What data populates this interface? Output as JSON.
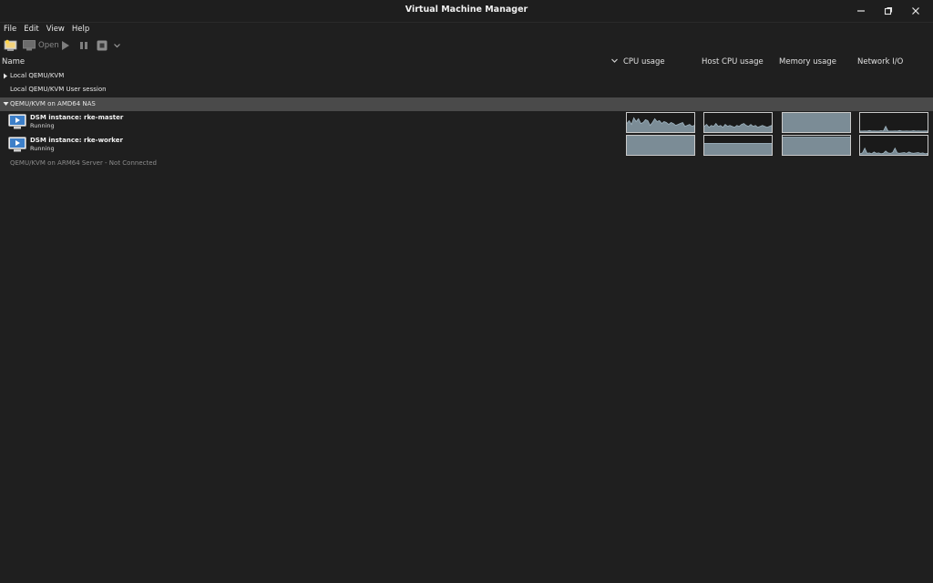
{
  "window": {
    "title": "Virtual Machine Manager"
  },
  "menu": [
    "File",
    "Edit",
    "View",
    "Help"
  ],
  "toolbar": {
    "open_label": "Open"
  },
  "columns": {
    "name": "Name",
    "cpu": "CPU usage",
    "host_cpu": "Host CPU usage",
    "memory": "Memory usage",
    "network": "Network I/O"
  },
  "connections": {
    "local": "Local QEMU/KVM",
    "user": "Local QEMU/KVM User session",
    "amd": "QEMU/KVM on AMD64 NAS",
    "arm": "QEMU/KVM on ARM64 Server - Not Connected"
  },
  "vms": [
    {
      "name": "DSM instance: rke-master",
      "status": "Running",
      "cpu": [
        0.45,
        0.6,
        0.4,
        0.75,
        0.55,
        0.7,
        0.45,
        0.5,
        0.65,
        0.6,
        0.35,
        0.5,
        0.7,
        0.55,
        0.6,
        0.45,
        0.55,
        0.5,
        0.4,
        0.5,
        0.45,
        0.35,
        0.4,
        0.45,
        0.5,
        0.3,
        0.35,
        0.4,
        0.3,
        0.35
      ],
      "host_cpu": [
        0.3,
        0.4,
        0.25,
        0.35,
        0.3,
        0.45,
        0.3,
        0.35,
        0.25,
        0.4,
        0.3,
        0.35,
        0.3,
        0.25,
        0.35,
        0.3,
        0.4,
        0.45,
        0.35,
        0.3,
        0.4,
        0.3,
        0.35,
        0.25,
        0.3,
        0.35,
        0.3,
        0.25,
        0.3,
        0.35
      ],
      "memory": 0.97,
      "network": [
        0.05,
        0.05,
        0.06,
        0.05,
        0.08,
        0.05,
        0.06,
        0.05,
        0.05,
        0.07,
        0.05,
        0.3,
        0.06,
        0.05,
        0.05,
        0.06,
        0.05,
        0.08,
        0.05,
        0.05,
        0.06,
        0.05,
        0.05,
        0.07,
        0.05,
        0.06,
        0.05,
        0.05,
        0.06,
        0.05
      ]
    },
    {
      "name": "DSM instance: rke-worker",
      "status": "Running",
      "cpu": [
        0.97,
        0.97,
        0.97,
        0.97,
        0.97,
        0.97,
        0.97,
        0.97,
        0.97,
        0.97,
        0.97,
        0.97,
        0.97,
        0.97,
        0.97,
        0.97,
        0.97,
        0.97,
        0.97,
        0.97,
        0.97,
        0.97,
        0.97,
        0.97,
        0.97,
        0.97,
        0.97,
        0.97,
        0.97,
        0.97
      ],
      "host_cpu": [
        0.6,
        0.6,
        0.6,
        0.6,
        0.6,
        0.6,
        0.6,
        0.6,
        0.6,
        0.6,
        0.6,
        0.6,
        0.6,
        0.6,
        0.6,
        0.6,
        0.6,
        0.6,
        0.6,
        0.6,
        0.6,
        0.6,
        0.6,
        0.6,
        0.6,
        0.6,
        0.6,
        0.6,
        0.6,
        0.6
      ],
      "memory": 0.93,
      "network": [
        0.06,
        0.1,
        0.35,
        0.08,
        0.1,
        0.06,
        0.15,
        0.08,
        0.1,
        0.06,
        0.08,
        0.2,
        0.1,
        0.08,
        0.12,
        0.35,
        0.1,
        0.08,
        0.1,
        0.12,
        0.08,
        0.15,
        0.1,
        0.08,
        0.1,
        0.12,
        0.08,
        0.1,
        0.06,
        0.08
      ]
    }
  ],
  "colors": {
    "graph_fill": "#7b8c96",
    "graph_line": "#9fb4c0",
    "selected_row": "#4a4a4a",
    "icon_blue": "#4a90d9"
  }
}
